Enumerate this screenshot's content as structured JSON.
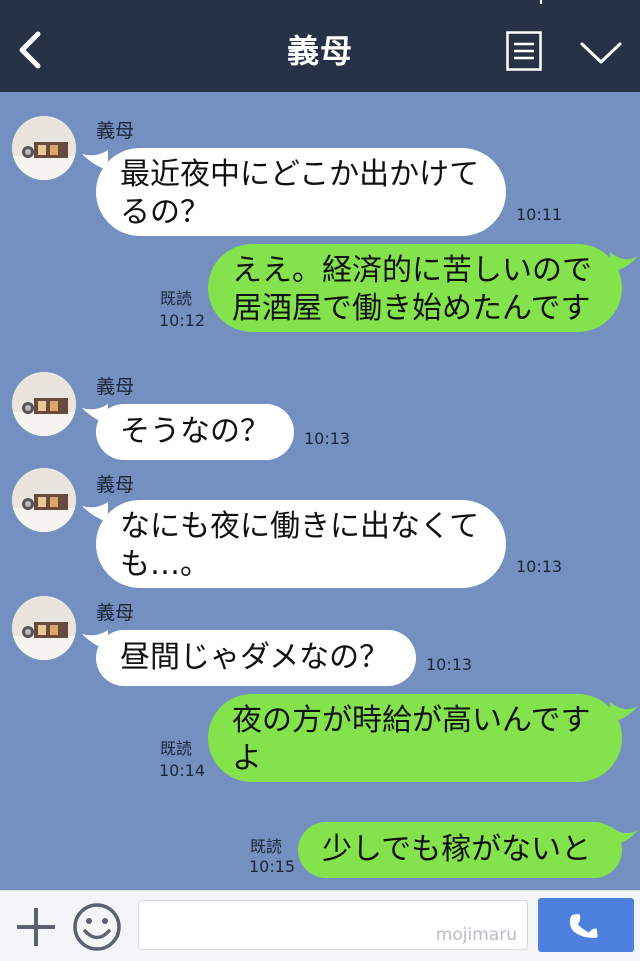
{
  "header": {
    "title": "義母"
  },
  "messages": [
    {
      "side": "in",
      "sender": "義母",
      "text": "最近夜中にどこか出かけて\nるの？",
      "time": "10:11"
    },
    {
      "side": "out",
      "read": "既読",
      "text": "ええ。経済的に苦しいので\n居酒屋で働き始めたんです",
      "time": "10:12"
    },
    {
      "side": "in",
      "sender": "義母",
      "text": "そうなの？",
      "time": "10:13"
    },
    {
      "side": "in",
      "sender": "義母",
      "text": "なにも夜に働きに出なくて\nも…。",
      "time": "10:13"
    },
    {
      "side": "in",
      "sender": "義母",
      "text": "昼間じゃダメなの？",
      "time": "10:13"
    },
    {
      "side": "out",
      "read": "既読",
      "text": "夜の方が時給が高いんです\nよ",
      "time": "10:14"
    },
    {
      "side": "out",
      "read": "既読",
      "text": "少しでも稼がないと",
      "time": "10:15"
    }
  ],
  "input": {
    "value": "",
    "watermark": "mojimaru"
  },
  "icons": {
    "back": "back-arrow-icon",
    "menu": "menu-list-icon",
    "expand": "chevron-down-icon",
    "add": "plus-icon",
    "emoji": "smiley-icon",
    "call": "phone-icon"
  },
  "colors": {
    "header_bg": "#273246",
    "chat_bg": "#7390c0",
    "incoming_bubble": "#ffffff",
    "outgoing_bubble": "#84e34c",
    "call_button": "#4d7fde"
  }
}
